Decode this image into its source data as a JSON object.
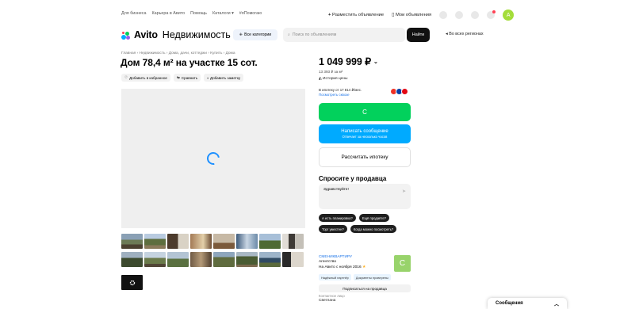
{
  "topnav": [
    "Для бизнеса",
    "Карьера в Авито",
    "Помощь",
    "Каталоги",
    "#яПомогаю"
  ],
  "topright": {
    "post": "Разместить объявление",
    "my_ads": "Мои объявления",
    "avatar_letter": "А"
  },
  "header": {
    "brand": "Avito",
    "section": "Недвижимость",
    "categories": "Все категории",
    "search_placeholder": "Поиск по объявлениям",
    "find": "Найти",
    "region": "Во всех регионах"
  },
  "breadcrumbs": "Главная › Недвижимость › Дома, дачи, коттеджи › Купить › Дома",
  "listing": {
    "title": "Дом 78,4 м² на участке 15 сот."
  },
  "actions": [
    "Добавить в избранное",
    "Сравнить",
    "Добавить заметку"
  ],
  "price": {
    "value": "1 049 999 ₽",
    "per_m2": "13 393 ₽ за м²",
    "history": "История цены"
  },
  "mortgage": {
    "line1": "В ипотеку от 17 814 ₽/мес.",
    "link": "Посмотреть сквозе"
  },
  "buttons": {
    "call": "С",
    "message": "Написать сообщение",
    "message_sub": "Отвечает за несколько часов",
    "mortgage": "Рассчитать ипотеку"
  },
  "ask": {
    "title": "Спросите у продавца",
    "placeholder": "Здравствуйте!",
    "chips": [
      "А есть планировка?",
      "Ещё продаёте?",
      "Торг уместен?",
      "Когда можно посмотреть?"
    ]
  },
  "seller": {
    "name": "СМЕНИКВАРТИРУ",
    "type": "Агентство",
    "since": "На Авито с ноября 2016",
    "avatar": "С",
    "badges": [
      "Надёжный партнёр",
      "Документы проверены"
    ],
    "subscribe": "Подписаться на продавца",
    "contact_label": "Контактное лицо",
    "contact_name": "Светлана"
  },
  "chat_panel": {
    "title": "Сообщения"
  },
  "colors": {
    "green": "#02d15c",
    "blue": "#00aaff",
    "link": "#1a73e8"
  }
}
